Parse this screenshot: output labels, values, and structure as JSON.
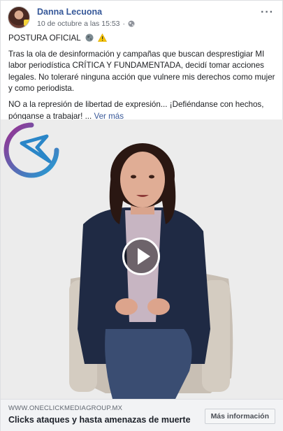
{
  "post": {
    "author": "Danna Lecuona",
    "timestamp": "10 de octubre a las 15:53",
    "privacy_icon": "globe-icon",
    "menu_icon": "more-options-icon",
    "title": "POSTURA OFICIAL",
    "title_emojis": [
      "earth-globe-emoji",
      "warning-emoji"
    ],
    "paragraph1": "Tras la ola de desinformación y campañas que buscan desprestigiar MI labor periodística CRÍTICA Y FUNDAMENTADA, decidí tomar acciones legales. No toleraré ninguna acción que vulnere mis derechos como mujer y como periodista.",
    "paragraph2": "NO a la represión de libertad de expresión... ¡Defiéndanse con hechos, pónganse a trabajar! ...",
    "see_more": "Ver más"
  },
  "video": {
    "play_icon": "play-icon",
    "logo_icon": "oneclick-logo-icon"
  },
  "link_card": {
    "domain": "WWW.ONECLICKMEDIAGROUP.MX",
    "headline": "Clicks ataques y hasta amenazas de muerte",
    "cta_label": "Más información"
  },
  "colors": {
    "author_link": "#365899",
    "see_more": "#385898",
    "card_bg": "#f2f3f5",
    "video_bg": "#ececec"
  }
}
